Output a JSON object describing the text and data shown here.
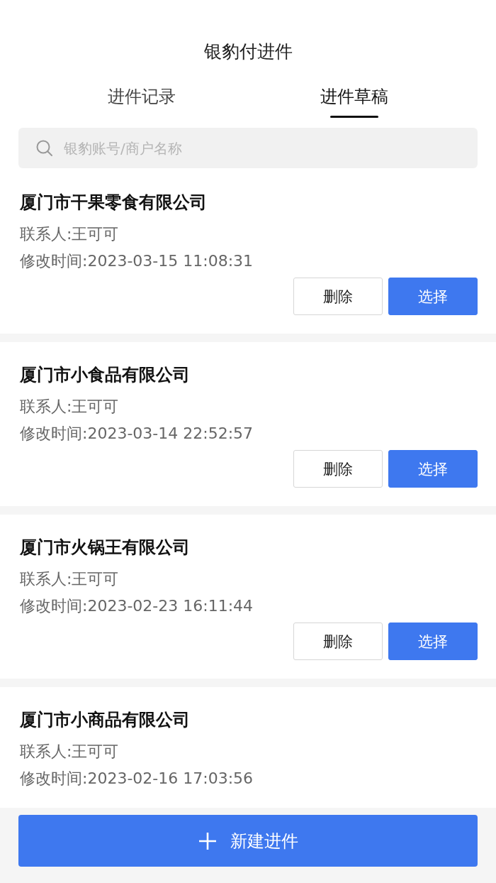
{
  "title": "银豹付进件",
  "tabs": [
    {
      "label": "进件记录",
      "selected": false
    },
    {
      "label": "进件草稿",
      "selected": true
    }
  ],
  "search": {
    "placeholder": "银豹账号/商户名称"
  },
  "drafts": [
    {
      "name": "厦门市干果零食有限公司",
      "contact": "联系人:王可可",
      "modified": "修改时间:2023-03-15 11:08:31",
      "buttons": [
        "删除",
        "选择"
      ]
    },
    {
      "name": "厦门市小食品有限公司",
      "contact": "联系人:王可可",
      "modified": "修改时间:2023-03-14 22:52:57",
      "buttons": [
        "删除",
        "选择"
      ]
    },
    {
      "name": "厦门市火锅王有限公司",
      "contact": "联系人:王可可",
      "modified": "修改时间:2023-02-23 16:11:44",
      "buttons": [
        "删除",
        "选择"
      ]
    },
    {
      "name": "厦门市小商品有限公司",
      "contact": "联系人:王可可",
      "modified": "修改时间:2023-02-16 17:03:56"
    }
  ],
  "new_button": {
    "label": "新建进件"
  }
}
